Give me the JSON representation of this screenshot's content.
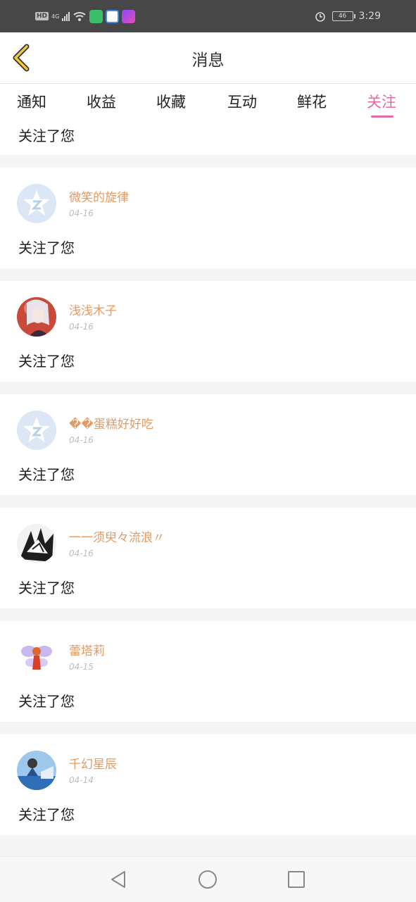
{
  "statusbar": {
    "hd": "HD",
    "net": "4G",
    "time": "3:29",
    "battery": "46"
  },
  "header": {
    "title": "消息"
  },
  "tabs": [
    {
      "label": "通知",
      "active": false
    },
    {
      "label": "收益",
      "active": false
    },
    {
      "label": "收藏",
      "active": false
    },
    {
      "label": "互动",
      "active": false
    },
    {
      "label": "鲜花",
      "active": false
    },
    {
      "label": "关注",
      "active": true
    }
  ],
  "partial": {
    "text": "关注了您"
  },
  "items": [
    {
      "name": "微笑的旋律",
      "date": "04-16",
      "text": "关注了您",
      "avatar": "default"
    },
    {
      "name": "浅浅木子",
      "date": "04-16",
      "text": "关注了您",
      "avatar": "anime-girl"
    },
    {
      "name": "��蛋糕好好吃",
      "date": "04-16",
      "text": "关注了您",
      "avatar": "default"
    },
    {
      "name": "一一须臾々流浪〃",
      "date": "04-16",
      "text": "关注了您",
      "avatar": "sketch"
    },
    {
      "name": "蕾塔莉",
      "date": "04-15",
      "text": "关注了您",
      "avatar": "fairy"
    },
    {
      "name": "千幻星辰",
      "date": "04-14",
      "text": "关注了您",
      "avatar": "photo"
    }
  ],
  "colors": {
    "accent": "#e46aa5",
    "username": "#e49a63",
    "back": "#f0c93a"
  }
}
